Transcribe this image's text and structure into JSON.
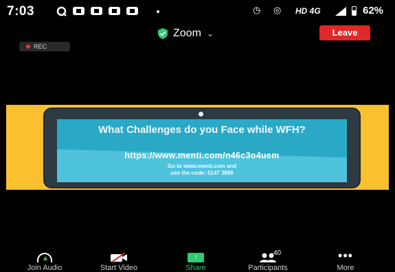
{
  "status_bar": {
    "time": "7:03",
    "network_label": "HD 4G",
    "battery": "62%",
    "icons": [
      "q-icon",
      "notification-icon",
      "notification-icon",
      "notification-icon",
      "notification-icon",
      "dot",
      "alarm-icon",
      "hotspot-icon",
      "signal-icon",
      "battery-icon"
    ]
  },
  "meeting": {
    "title": "Zoom",
    "leave_label": "Leave",
    "rec_label": "REC"
  },
  "shared_slide": {
    "title": "What Challenges do you Face while WFH?",
    "url": "https://www.menti.com/n46c3o4uem",
    "line1": "Go to www.menti.com and",
    "line2": "use the code: 5147 3896"
  },
  "toolbar": {
    "join_audio": "Join Audio",
    "start_video": "Start Video",
    "share": "Share",
    "participants": "Participants",
    "participants_count": "40",
    "more": "More"
  },
  "colors": {
    "leave": "#e02828",
    "share_bg": "#fbc02d",
    "screen": "#4fc3dc",
    "accent_green": "#2ecc71"
  }
}
